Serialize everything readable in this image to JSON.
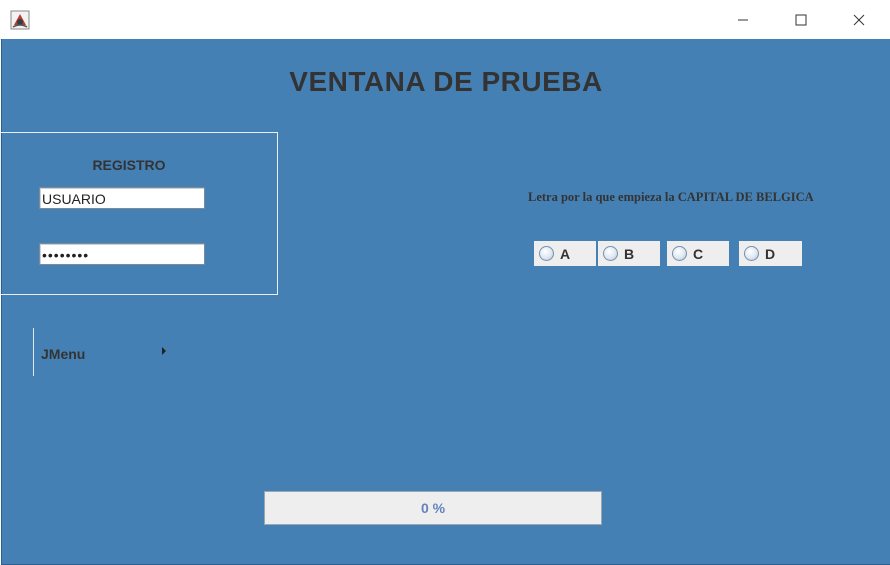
{
  "window": {
    "title": "VENTANA DE PRUEBA",
    "controls": [
      "minimize-icon",
      "maximize-icon",
      "close-icon"
    ]
  },
  "registro": {
    "title": "REGISTRO",
    "usuario_value": "USUARIO",
    "password_masked": "••••••••"
  },
  "menu": {
    "label": "JMenu",
    "icon": "submenu-arrow-icon"
  },
  "question": {
    "text": "Letra por la que empieza la CAPITAL DE BELGICA",
    "options": [
      "A",
      "B",
      "C",
      "D"
    ],
    "selected": null
  },
  "progress": {
    "value": 0,
    "label": "0 %"
  },
  "colors": {
    "background": "#4580b4",
    "text": "#333333",
    "progress_text": "#6382bf"
  }
}
